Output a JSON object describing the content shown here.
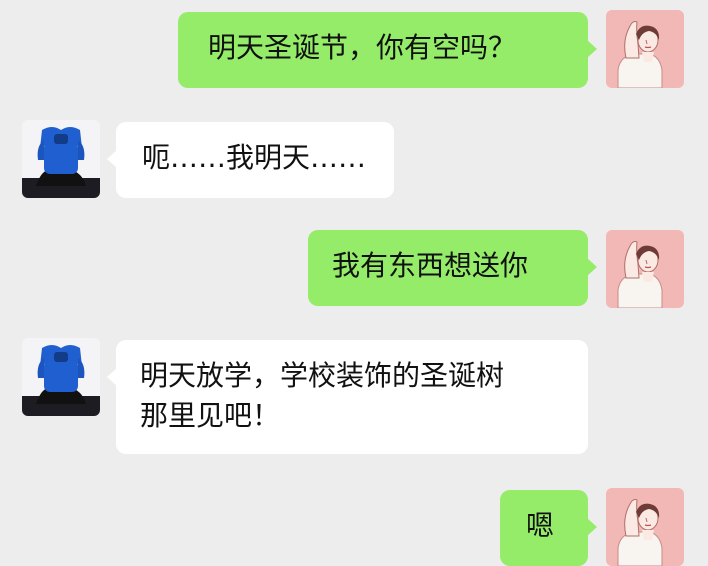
{
  "messages": [
    {
      "side": "sent",
      "text": "明天圣诞节，你有空吗？"
    },
    {
      "side": "received",
      "text": "呃……我明天……"
    },
    {
      "side": "sent",
      "text": "我有东西想送你"
    },
    {
      "side": "received",
      "lines": [
        "明天放学，学校装饰的圣诞树",
        "那里见吧！"
      ]
    },
    {
      "side": "sent",
      "text": "嗯"
    }
  ],
  "colors": {
    "background": "#ededed",
    "sent_bubble": "#95ec69",
    "received_bubble": "#ffffff",
    "self_avatar_bg": "#f2b8b5",
    "other_avatar_bg": "#f4f4f6",
    "other_avatar_shirt": "#1f5fd0"
  }
}
